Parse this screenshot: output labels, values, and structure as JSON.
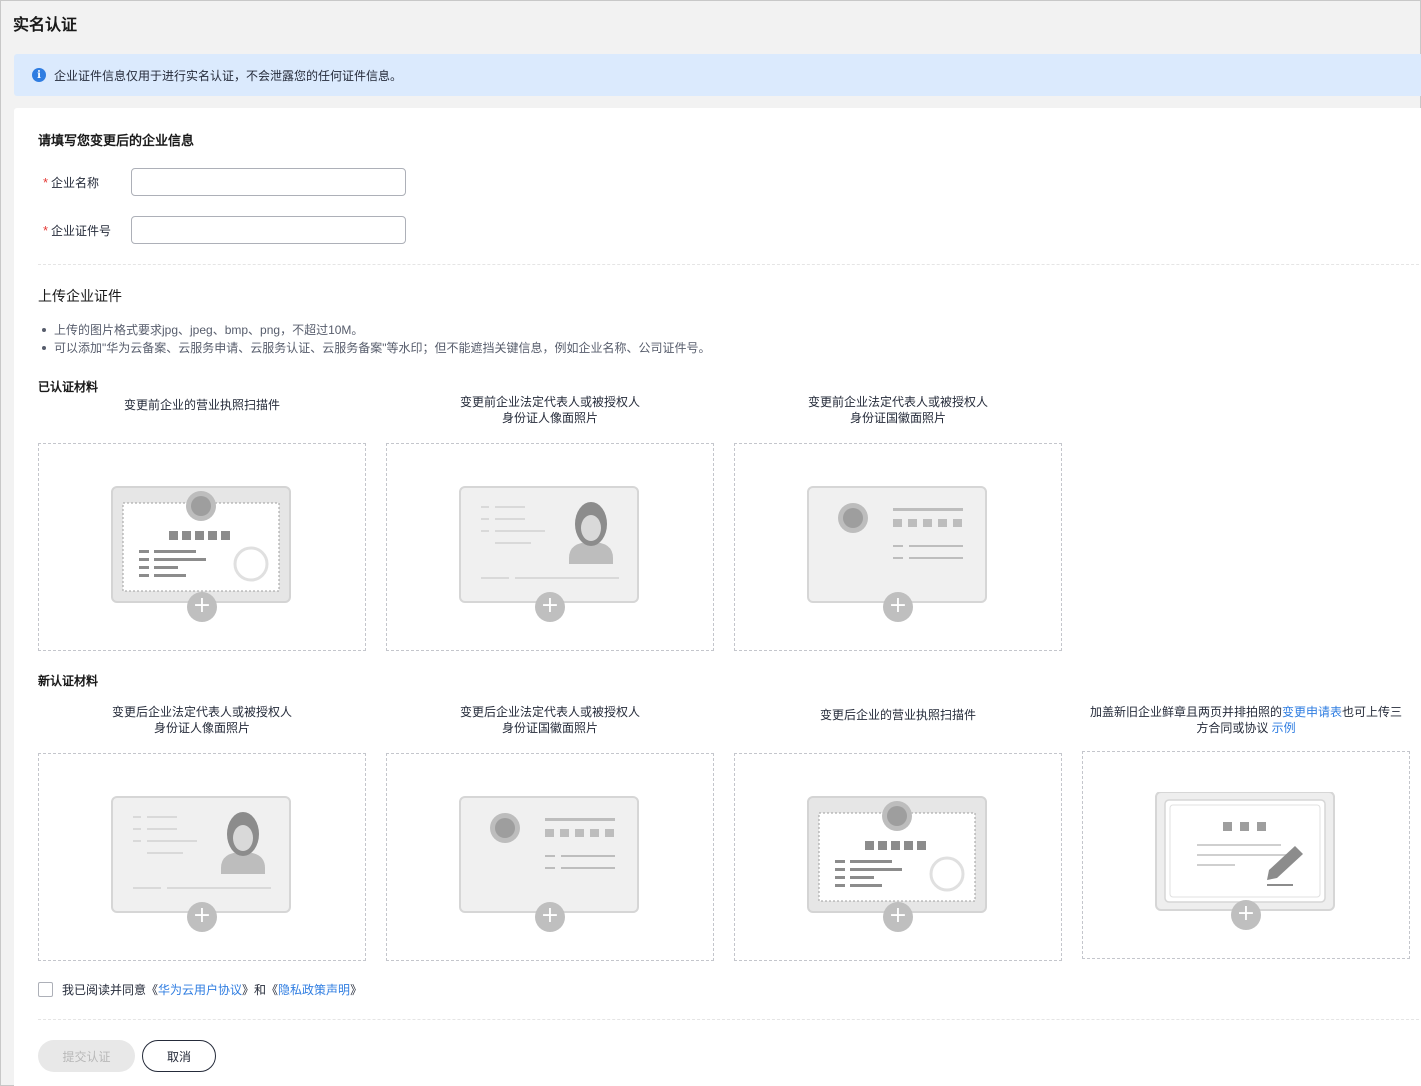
{
  "page": {
    "title": "实名认证"
  },
  "notice": {
    "text": "企业证件信息仅用于进行实名认证，不会泄露您的任何证件信息。"
  },
  "form": {
    "section_title": "请填写您变更后的企业信息",
    "company_name_label": "企业名称",
    "company_name_value": "",
    "company_id_label": "企业证件号",
    "company_id_value": "",
    "required_mark": "*"
  },
  "upload": {
    "title": "上传企业证件",
    "rules": [
      "上传的图片格式要求jpg、jpeg、bmp、png，不超过10M。",
      "可以添加\"华为云备案、云服务申请、云服务认证、云服务备案\"等水印；但不能遮挡关键信息，例如企业名称、公司证件号。"
    ],
    "old_group_title": "已认证材料",
    "old_items": [
      {
        "line1": "变更前企业的营业执照扫描件",
        "line2": ""
      },
      {
        "line1": "变更前企业法定代表人或被授权人",
        "line2": "身份证人像面照片"
      },
      {
        "line1": "变更前企业法定代表人或被授权人",
        "line2": "身份证国徽面照片"
      }
    ],
    "new_group_title": "新认证材料",
    "new_items": [
      {
        "line1": "变更后企业法定代表人或被授权人",
        "line2": "身份证人像面照片"
      },
      {
        "line1": "变更后企业法定代表人或被授权人",
        "line2": "身份证国徽面照片"
      },
      {
        "line1": "变更后企业的营业执照扫描件",
        "line2": ""
      }
    ],
    "extra_item": {
      "pre": "加盖新旧企业鲜章且两页并排拍照的",
      "link1": "变更申请表",
      "mid": "也可上传三",
      "line2": "方合同或协议",
      "link2": "示例"
    }
  },
  "agreement": {
    "prefix": "我已阅读并同意《",
    "link1": "华为云用户协议",
    "middle": "》和《",
    "link2": "隐私政策声明",
    "suffix": "》",
    "checked": false
  },
  "buttons": {
    "submit": "提交认证",
    "cancel": "取消"
  },
  "colors": {
    "accent": "#2f7de1",
    "notice_bg": "#dbeafd",
    "required": "#e53935"
  }
}
